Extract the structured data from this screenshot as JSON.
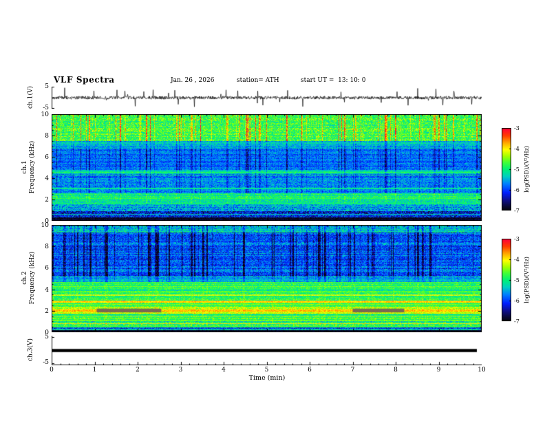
{
  "title": "VLF Spectra",
  "header": {
    "date": "Jan. 26 , 2026",
    "station": "station= ATH",
    "start_ut": "start UT =  13: 10: 0"
  },
  "xaxis": {
    "label": "Time (min)",
    "tick_labels": [
      "0",
      "1",
      "2",
      "3",
      "4",
      "5",
      "6",
      "7",
      "8",
      "9",
      "10"
    ],
    "range": [
      0,
      10
    ]
  },
  "panels": {
    "ch1_wave": {
      "ylabel": "ch.1(V)",
      "ytick_labels": [
        "5",
        "-5"
      ],
      "ylim": [
        -5,
        5
      ]
    },
    "ch1_spec": {
      "ylabel_line1": "ch.1",
      "ylabel_line2": "Frequency (kHz)",
      "ytick_labels": [
        "10",
        "8",
        "6",
        "4",
        "2",
        "0"
      ],
      "ylim": [
        0,
        10
      ]
    },
    "ch2_spec": {
      "ylabel_line1": "ch.2",
      "ylabel_line2": "Frequency (kHz)",
      "ytick_labels": [
        "10",
        "8",
        "6",
        "4",
        "2",
        "0"
      ],
      "ylim": [
        0,
        10
      ]
    },
    "ch3_wave": {
      "ylabel": "ch.3(V)",
      "ytick_labels": [
        "5",
        "-5"
      ],
      "ylim": [
        -5,
        5
      ]
    }
  },
  "colorbars": [
    {
      "label": "log(PSD)/(V²/Hz)",
      "tick_labels": [
        "-3",
        "-4",
        "-5",
        "-6",
        "-7"
      ],
      "range": [
        -7,
        -3
      ]
    },
    {
      "label": "log(PSD)/(V²/Hz)",
      "tick_labels": [
        "-3",
        "-4",
        "-5",
        "-6",
        "-7"
      ],
      "range": [
        -7,
        -3
      ]
    }
  ],
  "chart_data": [
    {
      "id": "ch1_waveform",
      "type": "line",
      "panel": "ch.1(V)",
      "xlabel": "Time (min)",
      "xlim": [
        0,
        10
      ],
      "ylim": [
        -5,
        5
      ],
      "summary": "Dense broadband noise centred on 0 V (about ±1 V) with frequent impulsive spikes reaching roughly ±4 V throughout the 10-minute record."
    },
    {
      "id": "ch1_spectrogram",
      "type": "heatmap",
      "panel": "ch.1 Frequency (kHz)",
      "xlim": [
        0,
        10
      ],
      "ylim": [
        0,
        10
      ],
      "colorbar": {
        "label": "log(PSD)/(V²/Hz)",
        "range": [
          -7,
          -3
        ],
        "ticks": [
          -3,
          -4,
          -5,
          -6,
          -7
        ]
      },
      "features": [
        "7.5-10 kHz: green background (about -4.5) crossed by many vertical red/orange transient streaks (up to -3)",
        "4.8-7.5 kHz: dark blue band (about -6) with darker vertical streaks",
        "2.6-4.4 kHz: blue speckle (about -5.8) with thin cyan horizontal lines near 4.5 and 3 kHz",
        "1.6-2.6 kHz: cyan/green band (about -5)",
        "0.35-0.9 kHz: dark dashed band",
        "0-0.35 kHz: black (at or below -7)"
      ]
    },
    {
      "id": "ch2_spectrogram",
      "type": "heatmap",
      "panel": "ch.2 Frequency (kHz)",
      "xlim": [
        0,
        10
      ],
      "ylim": [
        0,
        10
      ],
      "colorbar": {
        "label": "log(PSD)/(V²/Hz)",
        "range": [
          -7,
          -3
        ],
        "ticks": [
          -3,
          -4,
          -5,
          -6,
          -7
        ]
      },
      "features": [
        "5-10 kHz: dark blue region (about -6) with dense darker/black vertical streaks",
        "2.9-4.6 kHz: green horizontal banding (about -4.5) with yellow lines near 3.5 and 2.9 kHz",
        "1.75-2.35 kHz: bright yellow-green band (about -3.8) with grey saturated segments near 2 kHz at about 1-2.5 min and 7-8.2 min",
        "0.45-1.75 kHz: green with yellow/orange lines near 0.8 and 1.5 kHz",
        "0-0.2 kHz: black (at or below -7)"
      ]
    },
    {
      "id": "ch3_waveform",
      "type": "line",
      "panel": "ch.3(V)",
      "xlabel": "Time (min)",
      "xlim": [
        0,
        10
      ],
      "ylim": [
        -5,
        5
      ],
      "summary": "Flat thick line at 0 V for the entire record (no signal on channel 3)."
    }
  ],
  "render": {
    "spec1": {
      "seed": 101,
      "fmax": 10,
      "rowNoise": 0.1,
      "bands": [
        {
          "lo": 7.5,
          "hi": 10,
          "level": 0.56,
          "var": 0.13,
          "gain": 0.38
        },
        {
          "lo": 6.8,
          "hi": 7.5,
          "level": 0.4,
          "var": 0.1,
          "gain": -0.12
        },
        {
          "lo": 4.8,
          "hi": 6.8,
          "level": 0.3,
          "var": 0.09,
          "gain": -0.22
        },
        {
          "lo": 4.4,
          "hi": 4.8,
          "level": 0.45,
          "var": 0.08,
          "gain": -0.12
        },
        {
          "lo": 2.6,
          "hi": 4.4,
          "level": 0.33,
          "var": 0.1,
          "gain": -0.16
        },
        {
          "lo": 1.6,
          "hi": 2.6,
          "level": 0.48,
          "var": 0.11,
          "gain": 0.08
        },
        {
          "lo": 0.9,
          "hi": 1.6,
          "level": 0.36,
          "var": 0.13,
          "gain": -0.05
        },
        {
          "lo": 0.35,
          "hi": 0.9,
          "level": 0.2,
          "var": 0.16,
          "gain": 0.05
        },
        {
          "lo": 0,
          "hi": 0.35,
          "level": 0.05,
          "var": 0.05,
          "gain": 0
        }
      ],
      "lines": [
        {
          "f": 4.55,
          "t": 0.55
        },
        {
          "f": 4.3,
          "t": 0.5
        },
        {
          "f": 3.05,
          "t": 0.48
        },
        {
          "f": 2.1,
          "t": 0.56
        },
        {
          "f": 1.6,
          "t": 0.5
        },
        {
          "f": 1.2,
          "t": 0.46
        },
        {
          "f": 0.6,
          "t": 0.42
        }
      ],
      "gray": []
    },
    "spec2": {
      "seed": 202,
      "fmax": 10,
      "rowNoise": 0.14,
      "bands": [
        {
          "lo": 9.3,
          "hi": 10,
          "level": 0.4,
          "var": 0.13,
          "gain": -0.18
        },
        {
          "lo": 5.2,
          "hi": 9.3,
          "level": 0.28,
          "var": 0.11,
          "gain": -0.28
        },
        {
          "lo": 4.6,
          "hi": 5.2,
          "level": 0.4,
          "var": 0.09,
          "gain": -0.12
        },
        {
          "lo": 2.9,
          "hi": 4.6,
          "level": 0.52,
          "var": 0.1,
          "gain": 0.05
        },
        {
          "lo": 2.35,
          "hi": 2.9,
          "level": 0.55,
          "var": 0.09,
          "gain": 0.04
        },
        {
          "lo": 1.75,
          "hi": 2.35,
          "level": 0.66,
          "var": 0.09,
          "gain": 0.05
        },
        {
          "lo": 1.0,
          "hi": 1.75,
          "level": 0.54,
          "var": 0.1,
          "gain": 0.03
        },
        {
          "lo": 0.45,
          "hi": 1.0,
          "level": 0.5,
          "var": 0.14,
          "gain": 0.03
        },
        {
          "lo": 0.18,
          "hi": 0.45,
          "level": 0.3,
          "var": 0.12,
          "gain": 0
        },
        {
          "lo": 0,
          "hi": 0.18,
          "level": 0.05,
          "var": 0.04,
          "gain": 0
        }
      ],
      "lines": [
        {
          "f": 4.6,
          "t": 0.58
        },
        {
          "f": 4.25,
          "t": 0.62
        },
        {
          "f": 3.8,
          "t": 0.6
        },
        {
          "f": 3.45,
          "t": 0.7
        },
        {
          "f": 2.85,
          "t": 0.78,
          "w": 1.5
        },
        {
          "f": 2.55,
          "t": 0.62
        },
        {
          "f": 2.0,
          "t": 0.8,
          "w": 2
        },
        {
          "f": 1.5,
          "t": 0.68
        },
        {
          "f": 1.1,
          "t": 0.62
        },
        {
          "f": 0.8,
          "t": 0.76
        },
        {
          "f": 0.5,
          "t": 0.56
        },
        {
          "f": 0.3,
          "t": 0.5
        }
      ],
      "gray": [
        {
          "x0": 1.05,
          "x1": 2.55,
          "f0": 1.85,
          "f1": 2.2
        },
        {
          "x0": 7.0,
          "x1": 8.2,
          "f0": 1.85,
          "f1": 2.2
        }
      ]
    },
    "wave1_seed": 303
  }
}
